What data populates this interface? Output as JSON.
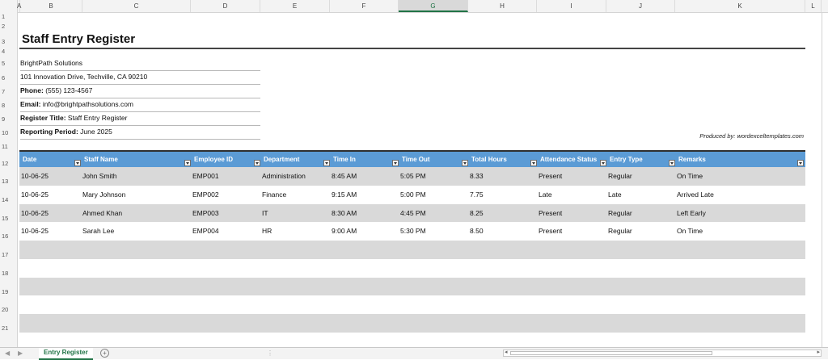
{
  "columns": [
    "A",
    "B",
    "C",
    "D",
    "E",
    "F",
    "G",
    "H",
    "I",
    "J",
    "K",
    "L"
  ],
  "rows": [
    "1",
    "2",
    "3",
    "4",
    "5",
    "6",
    "7",
    "8",
    "9",
    "10",
    "11",
    "12",
    "13",
    "14",
    "15",
    "16",
    "17",
    "18",
    "19",
    "20",
    "21"
  ],
  "header": {
    "title": "Staff Entry Register",
    "company": "BrightPath Solutions",
    "address": "101 Innovation Drive, Techville, CA 90210",
    "phone_label": "Phone:",
    "phone": "(555) 123-4567",
    "email_label": "Email:",
    "email": "info@brightpathsolutions.com",
    "register_title_label": "Register Title:",
    "register_title": "Staff Entry Register",
    "period_label": "Reporting Period:",
    "period": "June 2025",
    "produced_by": "Produced by: wordexceltemplates.com"
  },
  "table": {
    "headers": [
      "Date",
      "Staff Name",
      "Employee ID",
      "Department",
      "Time In",
      "Time Out",
      "Total Hours",
      "Attendance Status",
      "Entry Type",
      "Remarks"
    ],
    "rows": [
      [
        "10-06-25",
        "John Smith",
        "EMP001",
        "Administration",
        "8:45 AM",
        "5:05 PM",
        "8.33",
        "Present",
        "Regular",
        "On Time"
      ],
      [
        "10-06-25",
        "Mary Johnson",
        "EMP002",
        "Finance",
        "9:15 AM",
        "5:00 PM",
        "7.75",
        "Late",
        "Late",
        "Arrived Late"
      ],
      [
        "10-06-25",
        "Ahmed Khan",
        "EMP003",
        "IT",
        "8:30 AM",
        "4:45 PM",
        "8.25",
        "Present",
        "Regular",
        "Left Early"
      ],
      [
        "10-06-25",
        "Sarah Lee",
        "EMP004",
        "HR",
        "9:00 AM",
        "5:30 PM",
        "8.50",
        "Present",
        "Regular",
        "On Time"
      ],
      [
        "",
        "",
        "",
        "",
        "",
        "",
        "",
        "",
        "",
        ""
      ],
      [
        "",
        "",
        "",
        "",
        "",
        "",
        "",
        "",
        "",
        ""
      ],
      [
        "",
        "",
        "",
        "",
        "",
        "",
        "",
        "",
        "",
        ""
      ],
      [
        "",
        "",
        "",
        "",
        "",
        "",
        "",
        "",
        "",
        ""
      ],
      [
        "",
        "",
        "",
        "",
        "",
        "",
        "",
        "",
        "",
        ""
      ]
    ]
  },
  "tabs": {
    "sheet_name": "Entry Register",
    "add_icon": "plus-circle-icon",
    "prev_icon": "arrow-left-icon",
    "next_icon": "arrow-right-icon"
  },
  "colors": {
    "header_blue": "#5b9bd5",
    "shade": "#d9d9d9",
    "excel_green": "#217346"
  }
}
